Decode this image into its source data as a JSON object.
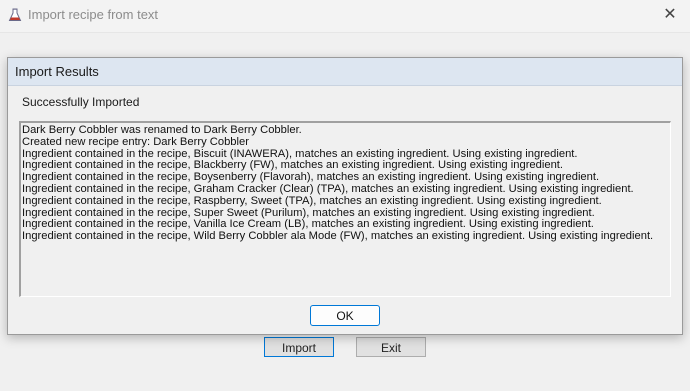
{
  "main_window": {
    "title": "Import recipe from text",
    "buttons": {
      "import": "Import",
      "exit": "Exit"
    }
  },
  "dialog": {
    "title": "Import Results",
    "status": "Successfully Imported",
    "results": [
      "Dark Berry Cobbler was renamed to Dark Berry Cobbler.",
      "Created new recipe entry: Dark Berry Cobbler",
      "Ingredient contained in the recipe, Biscuit (INAWERA), matches an existing ingredient. Using existing ingredient.",
      "Ingredient contained in the recipe, Blackberry (FW), matches an existing ingredient. Using existing ingredient.",
      "Ingredient contained in the recipe, Boysenberry (Flavorah), matches an existing ingredient. Using existing ingredient.",
      "Ingredient contained in the recipe, Graham Cracker (Clear) (TPA), matches an existing ingredient. Using existing ingredient.",
      "Ingredient contained in the recipe, Raspberry, Sweet (TPA), matches an existing ingredient. Using existing ingredient.",
      "Ingredient contained in the recipe, Super Sweet (Purilum), matches an existing ingredient. Using existing ingredient.",
      "Ingredient contained in the recipe, Vanilla Ice Cream (LB), matches an existing ingredient. Using existing ingredient.",
      "Ingredient contained in the recipe, Wild Berry Cobbler ala Mode (FW), matches an existing ingredient. Using existing ingredient."
    ],
    "ok_label": "OK"
  },
  "icons": {
    "app": "flask-icon",
    "close": "close-icon"
  },
  "colors": {
    "accent": "#0078d7",
    "dialog_titlebar": "#dde6f1"
  }
}
